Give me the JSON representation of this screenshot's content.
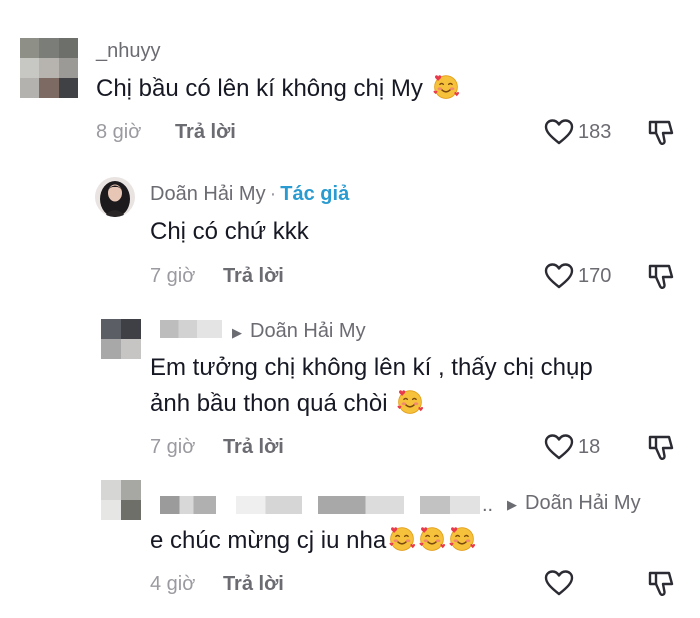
{
  "comments": [
    {
      "username": "_nhuyy",
      "text": "Chị bầu có lên kí không chị My",
      "time": "8 giờ",
      "reply_label": "Trả lời",
      "likes": "183"
    },
    {
      "username": "Doãn Hải My",
      "separator": "·",
      "author_tag": "Tác giả",
      "text": "Chị có chứ kkk",
      "time": "7 giờ",
      "reply_label": "Trả lời",
      "likes": "170"
    },
    {
      "reply_to": "Doãn Hải My",
      "text_line1": "Em tưởng chị không lên kí , thấy chị chụp",
      "text_line2": "ảnh bầu thon quá chòi",
      "time": "7 giờ",
      "reply_label": "Trả lời",
      "likes": "18"
    },
    {
      "ellipsis": "..",
      "reply_to": "Doãn Hải My",
      "text": "e chúc mừng cj iu nha",
      "time": "4 giờ",
      "reply_label": "Trả lời",
      "likes": ""
    }
  ],
  "icons": {
    "like": "heart-outline-icon",
    "dislike": "thumbs-down-icon",
    "emoji": "smiling-face-with-hearts-emoji"
  },
  "colors": {
    "author_tag": "#2a9bd1",
    "text": "#161823",
    "secondary": "#6b6b72",
    "muted": "#9a9aa0"
  }
}
